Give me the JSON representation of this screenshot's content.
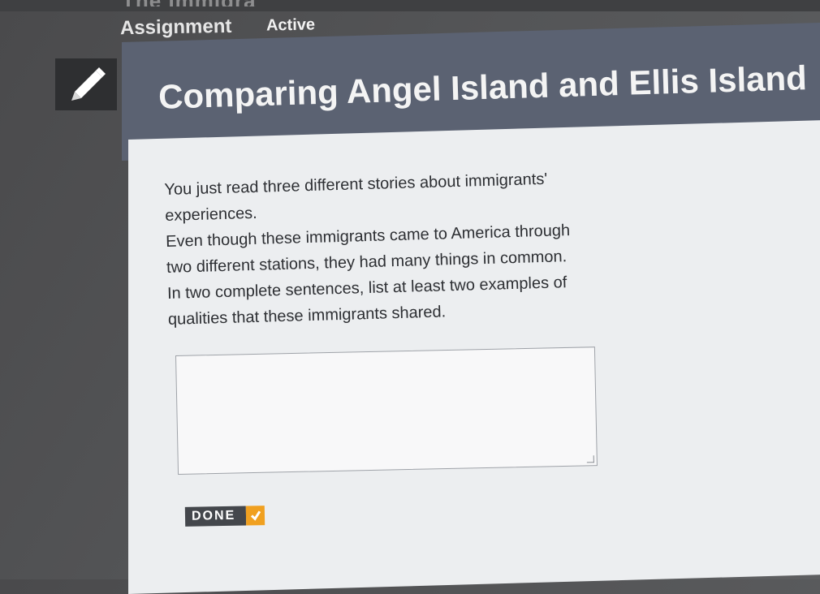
{
  "header": {
    "partial_title": "The Immigra",
    "assignment_label": "Assignment",
    "status": "Active"
  },
  "icons": {
    "edit": "pencil-icon",
    "done": "checkmark-icon"
  },
  "lesson": {
    "title": "Comparing Angel Island and Ellis Island",
    "prompt_lines": [
      "You just read three different stories about immigrants' experiences.",
      "Even though these immigrants came to America through two different stations, they had many things in common.",
      "In two complete sentences, list at least two examples of qualities that these immigrants shared."
    ]
  },
  "answer": {
    "value": "",
    "placeholder": ""
  },
  "done_button": {
    "label": "DONE"
  },
  "colors": {
    "header_band": "#5b6272",
    "panel": "#eceef0",
    "done_button": "#44474c",
    "check_accent": "#f0a020"
  }
}
